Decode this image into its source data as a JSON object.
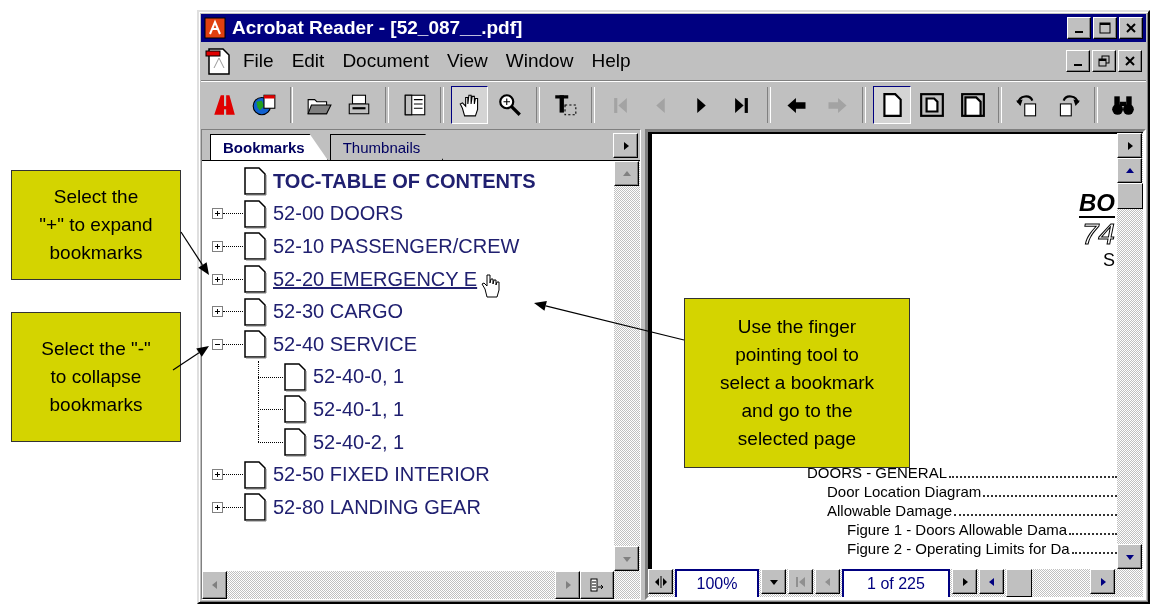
{
  "window": {
    "title": "Acrobat Reader - [52_087__.pdf]"
  },
  "menu": [
    {
      "label": "File"
    },
    {
      "label": "Edit"
    },
    {
      "label": "Document"
    },
    {
      "label": "View"
    },
    {
      "label": "Window"
    },
    {
      "label": "Help"
    }
  ],
  "toolbar": [
    {
      "kind": "logo",
      "selected": false,
      "disabled": false
    },
    {
      "kind": "web",
      "selected": false,
      "disabled": false
    },
    {
      "kind": "separator"
    },
    {
      "kind": "open",
      "selected": false,
      "disabled": false
    },
    {
      "kind": "print",
      "selected": false,
      "disabled": false
    },
    {
      "kind": "separator"
    },
    {
      "kind": "pane",
      "selected": false,
      "disabled": false
    },
    {
      "kind": "separator"
    },
    {
      "kind": "hand",
      "selected": true,
      "disabled": false
    },
    {
      "kind": "zoom",
      "selected": false,
      "disabled": false
    },
    {
      "kind": "separator"
    },
    {
      "kind": "text",
      "selected": false,
      "disabled": false
    },
    {
      "kind": "separator"
    },
    {
      "kind": "first",
      "selected": false,
      "disabled": true
    },
    {
      "kind": "prev",
      "selected": false,
      "disabled": true
    },
    {
      "kind": "next",
      "selected": false,
      "disabled": false
    },
    {
      "kind": "last",
      "selected": false,
      "disabled": false
    },
    {
      "kind": "separator"
    },
    {
      "kind": "back",
      "selected": false,
      "disabled": false
    },
    {
      "kind": "forward",
      "selected": false,
      "disabled": true
    },
    {
      "kind": "separator"
    },
    {
      "kind": "single",
      "selected": true,
      "disabled": false
    },
    {
      "kind": "fit",
      "selected": false,
      "disabled": false
    },
    {
      "kind": "width",
      "selected": false,
      "disabled": false
    },
    {
      "kind": "separator"
    },
    {
      "kind": "rotl",
      "selected": false,
      "disabled": false
    },
    {
      "kind": "rotr",
      "selected": false,
      "disabled": false
    },
    {
      "kind": "separator"
    },
    {
      "kind": "find",
      "selected": false,
      "disabled": false
    }
  ],
  "bookmarks_panel": {
    "tabs": [
      {
        "label": "Bookmarks",
        "selected": true
      },
      {
        "label": "Thumbnails",
        "selected": false
      }
    ],
    "tree": [
      {
        "label": "TOC-TABLE OF CONTENTS",
        "kind": "heading",
        "selected": false
      },
      {
        "label": "52-00 DOORS",
        "kind": "entry",
        "expanded": false,
        "selected": false
      },
      {
        "label": "52-10 PASSENGER/CREW",
        "kind": "entry",
        "expanded": false,
        "selected": false
      },
      {
        "label": "52-20 EMERGENCY E",
        "kind": "entry",
        "expanded": false,
        "selected": true
      },
      {
        "label": "52-30 CARGO",
        "kind": "entry",
        "expanded": false,
        "selected": false
      },
      {
        "label": "52-40 SERVICE",
        "kind": "entry",
        "expanded": true,
        "selected": false,
        "children": [
          {
            "label": "52-40-0, 1",
            "selected": false
          },
          {
            "label": "52-40-1, 1",
            "selected": false
          },
          {
            "label": "52-40-2, 1",
            "selected": false
          }
        ]
      },
      {
        "label": "52-50 FIXED INTERIOR",
        "kind": "entry",
        "expanded": false,
        "selected": false
      },
      {
        "label": "52-80 LANDING GEAR",
        "kind": "entry",
        "expanded": false,
        "selected": false
      }
    ]
  },
  "document": {
    "header": [
      "BO",
      "74",
      "S"
    ],
    "contents": [
      {
        "title": "DOORS - GENERAL",
        "children": [
          {
            "title": "Door Location Diagram"
          },
          {
            "title": "Allowable Damage",
            "children": [
              {
                "title": "Figure 1 - Doors Allowable Dama"
              },
              {
                "title": "Figure 2 - Operating Limits for Da"
              }
            ]
          }
        ]
      }
    ]
  },
  "status_bar": {
    "zoom": "100%",
    "page": "1 of 225"
  },
  "callouts": [
    {
      "text": "Select the\n\"+\" to expand\nbookmarks"
    },
    {
      "text": "Select the \"-\"\nto collapse\nbookmarks"
    },
    {
      "text": "Use the finger\npointing tool to\nselect a bookmark\nand go to the\nselected page"
    }
  ]
}
